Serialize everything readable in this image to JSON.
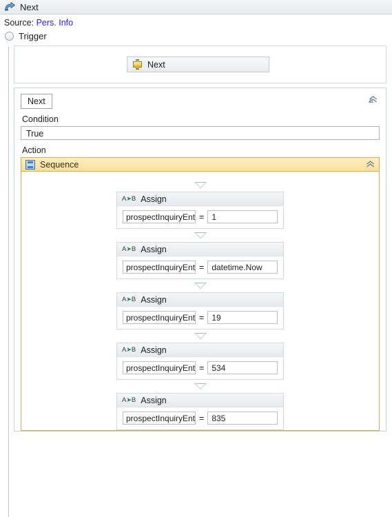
{
  "window": {
    "title": "Next",
    "icon": "flow-arrow-icon"
  },
  "source": {
    "label": "Source:",
    "link_text": "Pers. Info"
  },
  "trigger": {
    "label": "Trigger",
    "node": {
      "label": "Next",
      "icon": "state-node-icon"
    }
  },
  "state": {
    "tab_label": "Next",
    "collapse_icon": "chevron-double-up-icon",
    "condition_label": "Condition",
    "condition_value": "True",
    "action_label": "Action"
  },
  "sequence": {
    "title": "Sequence",
    "icon": "sequence-icon",
    "collapse_icon": "chevron-double-up-icon",
    "activities": [
      {
        "type": "Assign",
        "icon": "assign-ab-icon",
        "left": "prospectInquiryEnt",
        "operator": "=",
        "right": "1"
      },
      {
        "type": "Assign",
        "icon": "assign-ab-icon",
        "left": "prospectInquiryEnt",
        "operator": "=",
        "right": "datetime.Now"
      },
      {
        "type": "Assign",
        "icon": "assign-ab-icon",
        "left": "prospectInquiryEnt",
        "operator": "=",
        "right": "19"
      },
      {
        "type": "Assign",
        "icon": "assign-ab-icon",
        "left": "prospectInquiryEnt",
        "operator": "=",
        "right": "534"
      },
      {
        "type": "Assign",
        "icon": "assign-ab-icon",
        "left": "prospectInquiryEnt",
        "operator": "=",
        "right": "835"
      }
    ]
  },
  "colors": {
    "sequence_border": "#d8ab4a",
    "sequence_header_top": "#fdeec3",
    "sequence_header_bottom": "#fbdf9c",
    "link": "#1f1fdd",
    "state_panel_border": "#b9d4dd",
    "assign_border": "#d2d8de"
  }
}
